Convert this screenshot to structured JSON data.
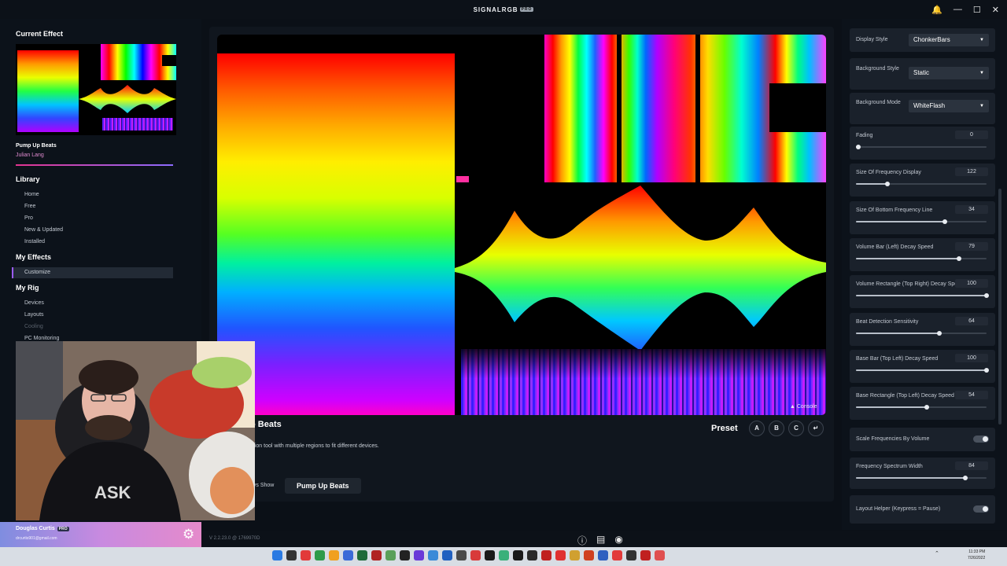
{
  "app": {
    "title": "SIGNALRGB",
    "edition_badge": "PRO",
    "window_controls": {
      "notifications_icon": "bell-icon",
      "minimize_icon": "minimize-icon",
      "maximize_icon": "maximize-icon",
      "close_icon": "close-icon"
    }
  },
  "sidebar": {
    "current_effect_heading": "Current Effect",
    "effect_name": "Pump Up Beats",
    "effect_author": "Julian Lang",
    "sections": [
      {
        "heading": "Library",
        "items": [
          "Home",
          "Free",
          "Pro",
          "New & Updated",
          "Installed"
        ]
      },
      {
        "heading": "My Effects",
        "items": [
          "Customize"
        ]
      },
      {
        "heading": "My Rig",
        "items": [
          "Devices",
          "Layouts",
          "Cooling",
          "PC Monitoring"
        ]
      }
    ],
    "active_item": "Customize",
    "disabled_item": "Cooling"
  },
  "user": {
    "name": "Douglas Curtis",
    "badge": "PRO",
    "email": "drcurtis901@gmail.com",
    "settings_icon": "gear-icon"
  },
  "main": {
    "effect_title": "Pump Up Beats",
    "effect_title_visible": "o Beats",
    "description_visible": "ation tool with multiple regions to fit different devices.",
    "always_show_visible": "ays Show",
    "preset_pill": "Pump Up Beats",
    "console_label": "▲ Console",
    "preset_label": "Preset",
    "preset_buttons": [
      "A",
      "B",
      "C",
      "↵"
    ]
  },
  "settings": {
    "display_style": {
      "label": "Display Style",
      "value": "ChonkerBars"
    },
    "background_style": {
      "label": "Background Style",
      "value": "Static"
    },
    "background_mode": {
      "label": "Background Mode",
      "value": "WhiteFlash"
    },
    "sliders": [
      {
        "label": "Fading",
        "value": "0",
        "fraction": 0.02
      },
      {
        "label": "Size Of Frequency Display",
        "value": "122",
        "fraction": 0.24
      },
      {
        "label": "Size Of Bottom Frequency Line",
        "value": "34",
        "fraction": 0.68
      },
      {
        "label": "Volume Bar (Left) Decay Speed",
        "value": "79",
        "fraction": 0.79
      },
      {
        "label": "Volume Rectangle (Top Right) Decay Speed",
        "value": "100",
        "fraction": 1.0
      },
      {
        "label": "Beat Detection Sensitivity",
        "value": "64",
        "fraction": 0.64
      },
      {
        "label": "Base Bar (Top Left) Decay Speed",
        "value": "100",
        "fraction": 1.0
      },
      {
        "label": "Base Rectangle (Top Left) Decay Speed",
        "value": "54",
        "fraction": 0.54
      }
    ],
    "scale_toggle": {
      "label": "Scale Frequencies By Volume",
      "on": true
    },
    "spectrum_width": {
      "label": "Frequency Spectrum Width",
      "value": "84",
      "fraction": 0.84
    },
    "layout_helper": {
      "label": "Layout Helper (Keypress = Pause)",
      "on": true
    }
  },
  "statusbar": {
    "version": "V 2.2.23.0 @ 1769970D",
    "icons": [
      "help-icon",
      "book-icon",
      "discord-icon"
    ]
  },
  "taskbar": {
    "time": "11:33 PM",
    "date": "7/26/2022",
    "tray_icon": "chevron-up-icon"
  },
  "colors": {
    "accent_gradient_start": "#e2348f",
    "accent_gradient_end": "#8d6bff",
    "background": "#0b1017",
    "card": "#1a212b"
  }
}
